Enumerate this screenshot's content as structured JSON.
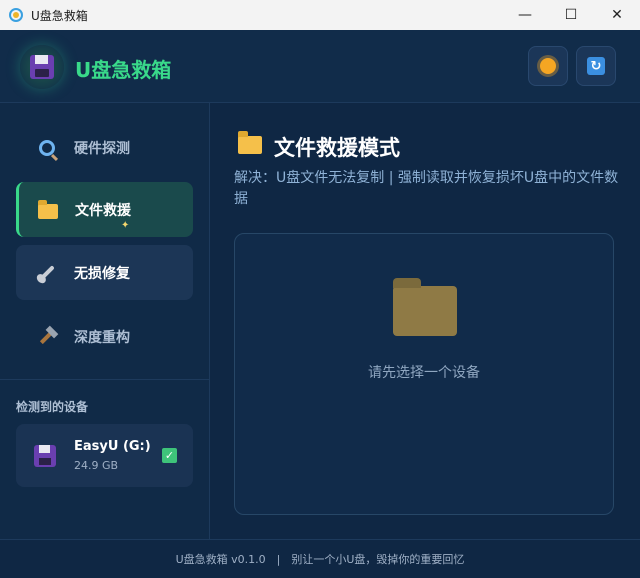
{
  "window": {
    "title": "U盘急救箱",
    "minimize_glyph": "—",
    "maximize_glyph": "☐",
    "close_glyph": "✕"
  },
  "header": {
    "brand": "U盘急救箱",
    "brand_color": "#39d98a",
    "theme_button_icon": "sun-icon",
    "refresh_button_icon": "refresh-icon"
  },
  "sidebar": {
    "items": [
      {
        "label": "硬件探测",
        "icon": "magnifier-icon",
        "active": false
      },
      {
        "label": "文件救援",
        "icon": "folder-icon",
        "active": true
      },
      {
        "label": "无损修复",
        "icon": "wrench-icon",
        "active": false,
        "hovered": true
      },
      {
        "label": "深度重构",
        "icon": "hammer-icon",
        "active": false
      }
    ],
    "devices_heading": "检测到的设备",
    "devices": [
      {
        "name": "EasyU (G:)",
        "size": "24.9 GB",
        "selected": true
      }
    ]
  },
  "main": {
    "title": "文件救援模式",
    "description": "解决：U盘文件无法复制 | 强制读取并恢复损坏U盘中的文件数据",
    "empty_state": "请先选择一个设备"
  },
  "footer": {
    "text": "U盘急救箱 v0.1.0　|　别让一个小U盘，毁掉你的重要回忆"
  }
}
